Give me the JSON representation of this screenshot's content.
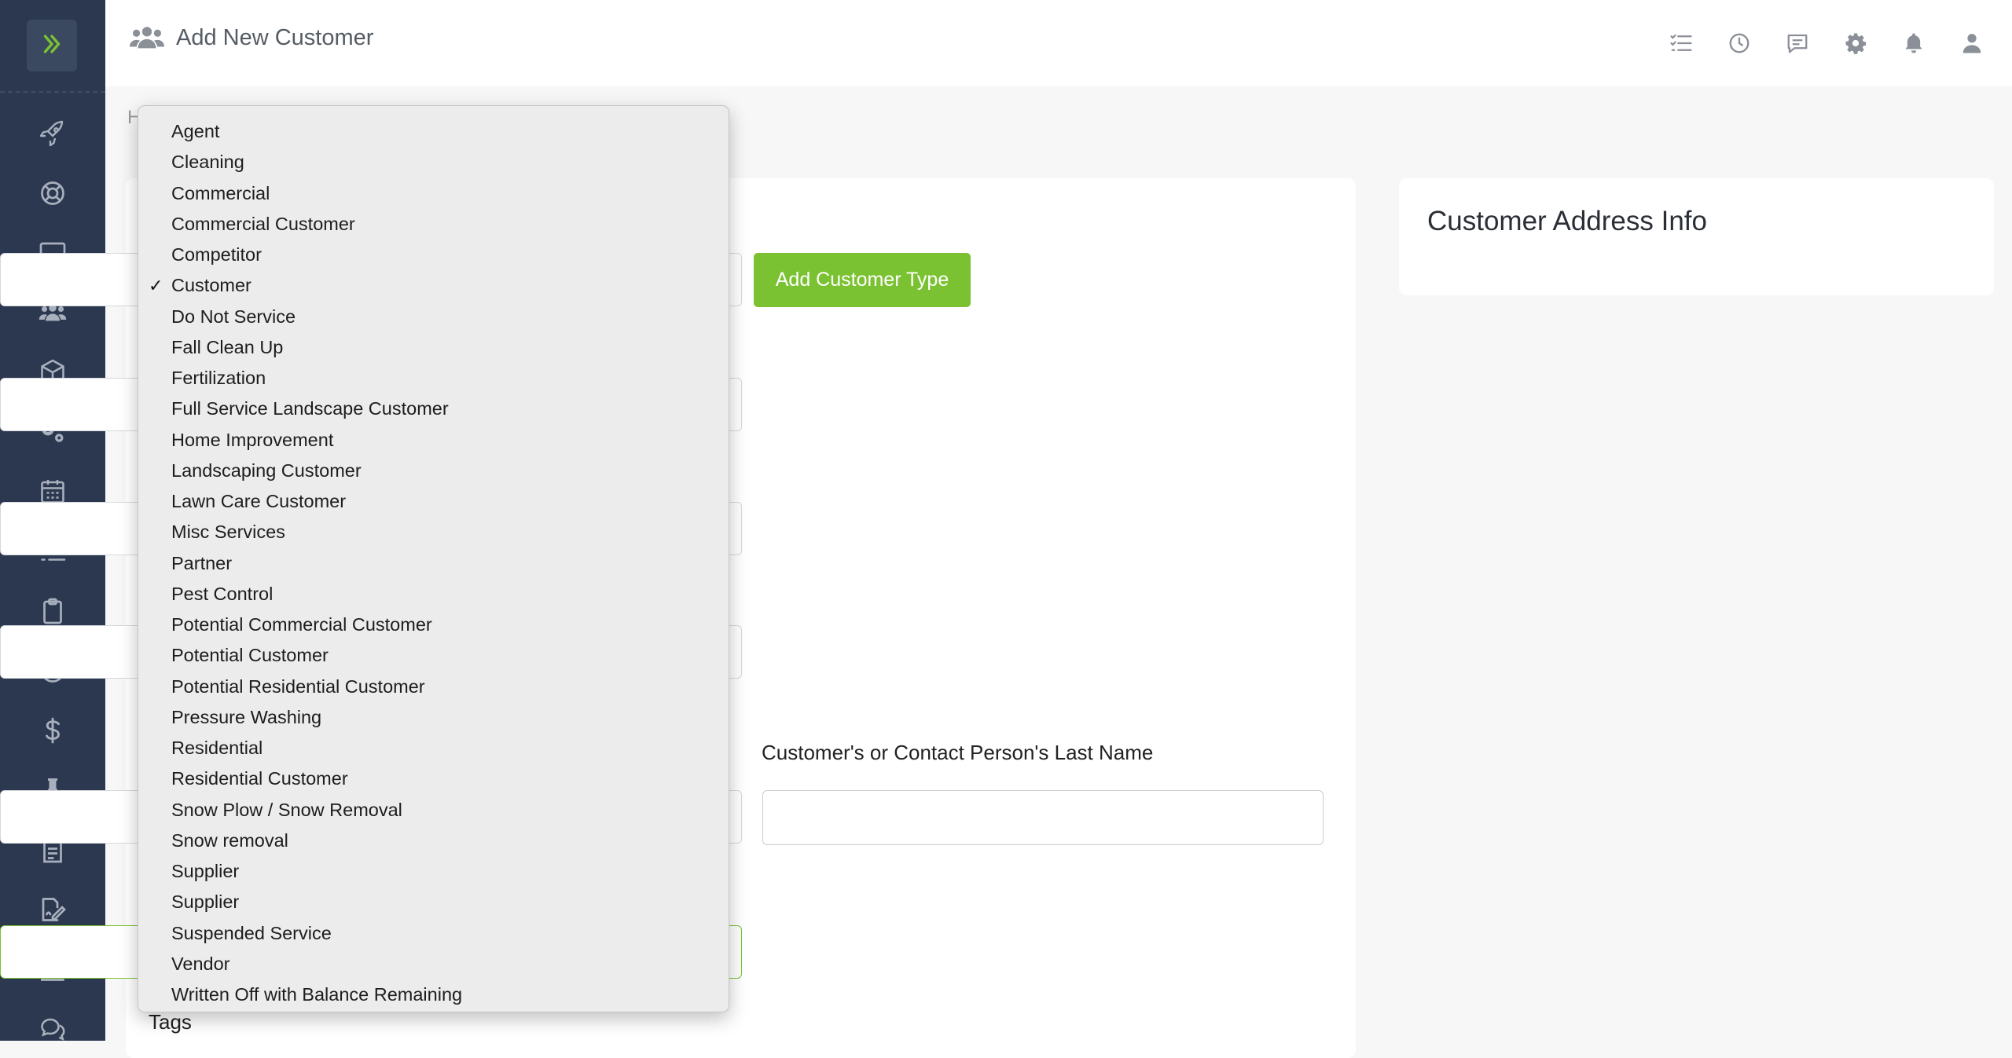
{
  "header": {
    "title": "Add New Customer",
    "title_icon": "users-icon",
    "icons": [
      "tasks-icon",
      "clock-icon",
      "message-icon",
      "gear-icon",
      "bell-icon",
      "user-icon"
    ]
  },
  "sidebar": {
    "toggle_icon": "double-chevron-right-icon",
    "items": [
      {
        "icon": "rocket-icon"
      },
      {
        "icon": "lifebuoy-icon"
      },
      {
        "icon": "monitor-icon"
      },
      {
        "icon": "users-icon"
      },
      {
        "icon": "cube-icon"
      },
      {
        "icon": "gears-icon"
      },
      {
        "icon": "calendar-icon"
      },
      {
        "icon": "task-list-icon"
      },
      {
        "icon": "clipboard-icon"
      },
      {
        "icon": "clock-icon"
      },
      {
        "icon": "dollar-icon"
      },
      {
        "icon": "flask-icon"
      },
      {
        "icon": "document-icon"
      },
      {
        "icon": "signature-icon"
      },
      {
        "icon": "bar-chart-icon"
      },
      {
        "icon": "chat-icon"
      }
    ]
  },
  "breadcrumb": {
    "visible_text": "H"
  },
  "form": {
    "add_customer_type_label": "Add Customer Type",
    "last_name_label": "Customer's or Contact Person's Last Name",
    "last_name_value": "",
    "tags_label": "Tags"
  },
  "address_card": {
    "title": "Customer Address Info"
  },
  "customer_type_dropdown": {
    "selected": "Customer",
    "options": [
      "Agent",
      "Cleaning",
      "Commercial",
      "Commercial Customer",
      "Competitor",
      "Customer",
      "Do Not Service",
      "Fall Clean Up",
      "Fertilization",
      "Full Service Landscape Customer",
      "Home Improvement",
      "Landscaping Customer",
      "Lawn Care Customer",
      "Misc Services",
      "Partner",
      "Pest Control",
      "Potential Commercial Customer",
      "Potential Customer",
      "Potential Residential Customer",
      "Pressure Washing",
      "Residential",
      "Residential Customer",
      "Snow Plow / Snow Removal",
      "Snow removal",
      "Supplier",
      "Supplier",
      "Suspended Service",
      "Vendor",
      "Written Off with Balance Remaining"
    ]
  },
  "colors": {
    "sidebar_bg": "#2b3850",
    "accent_green": "#7ac231",
    "icon_gray": "#8a8f98"
  }
}
